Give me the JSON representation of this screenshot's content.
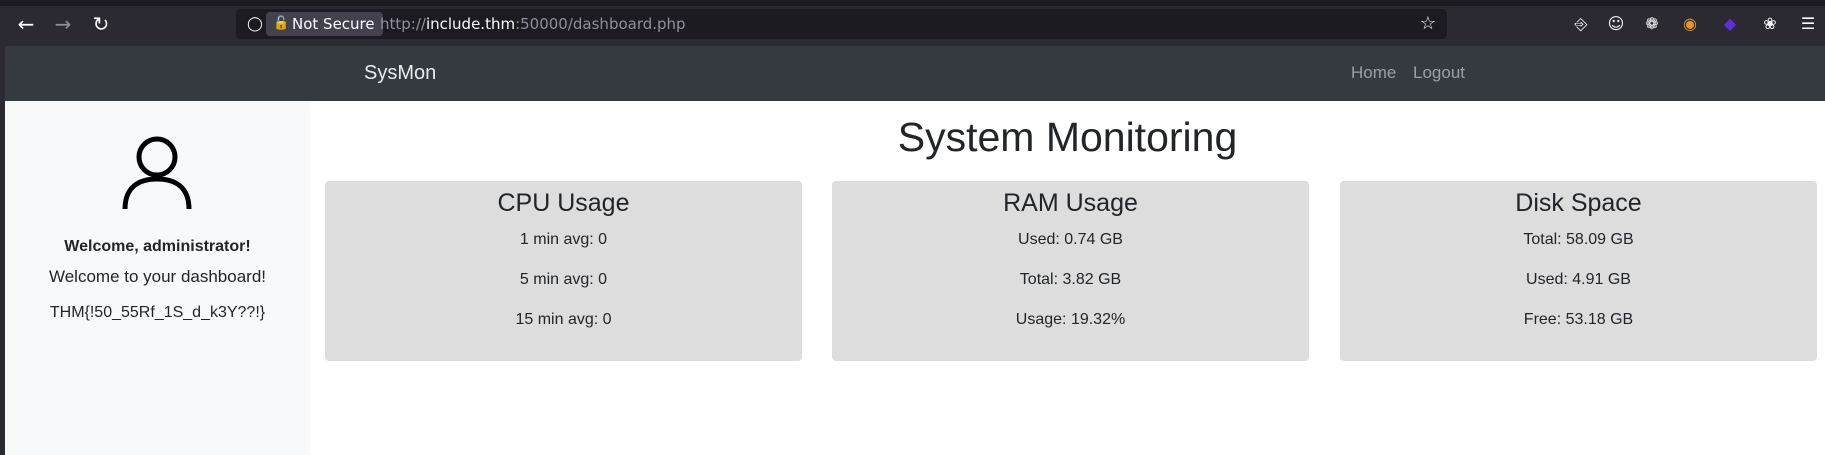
{
  "browser": {
    "security_label": "Not Secure",
    "url_host": "include.thm",
    "url_rest": ":50000/dashboard.php",
    "url_scheme": "http://"
  },
  "navbar": {
    "brand": "SysMon",
    "links": [
      "Home",
      "Logout"
    ]
  },
  "sidebar": {
    "welcome_user": "Welcome, administrator!",
    "welcome_msg": "Welcome to your dashboard!",
    "flag": "THM{!50_55Rf_1S_d_k3Y??!}"
  },
  "main": {
    "title": "System Monitoring",
    "cards": [
      {
        "title": "CPU Usage",
        "lines": [
          "1 min avg: 0",
          "5 min avg: 0",
          "15 min avg: 0"
        ]
      },
      {
        "title": "RAM Usage",
        "lines": [
          "Used: 0.74 GB",
          "Total: 3.82 GB",
          "Usage: 19.32%"
        ]
      },
      {
        "title": "Disk Space",
        "lines": [
          "Total: 58.09 GB",
          "Used: 4.91 GB",
          "Free: 53.18 GB"
        ]
      }
    ]
  },
  "icons": {
    "toolbar": [
      "back-icon",
      "forward-icon",
      "reload-icon",
      "shield-icon",
      "lock-icon",
      "star-icon",
      "pocket-icon",
      "account-icon",
      "extensions-icon",
      "extension-orange-icon",
      "extension-purple-icon",
      "cookie-icon",
      "menu-icon"
    ],
    "sidebar": [
      "user-icon"
    ]
  }
}
